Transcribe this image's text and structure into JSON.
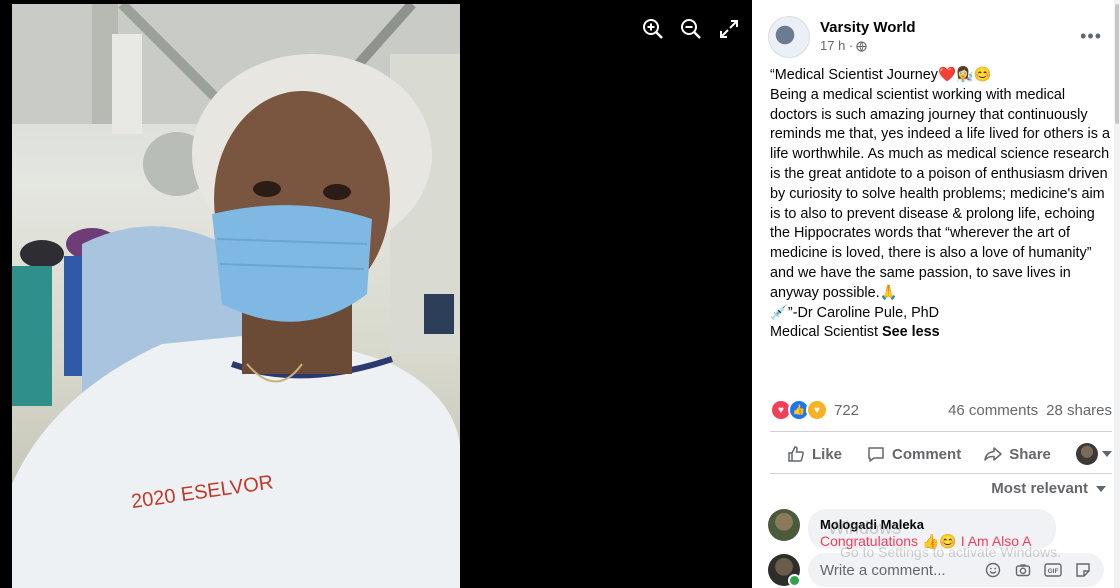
{
  "viewer": {
    "icons": [
      "zoom-in-icon",
      "zoom-out-icon",
      "fullscreen-icon"
    ],
    "photo_text": "2020 ESELVOR"
  },
  "post": {
    "page_name": "Varsity World",
    "time": "17 h ·",
    "body_lines": [
      "“Medical Scientist Journey❤️👩‍🔬😊",
      "Being a medical scientist working with medical doctors is such amazing journey that continuously reminds me that, yes indeed a life lived for others is a life worthwhile. As much as medical science research is the great antidote to a poison of enthusiasm driven by curiosity to solve health problems; medicine's aim is to also to prevent disease & prolong life, echoing the Hippocrates words that “wherever the art of medicine is loved, there is also a love of humanity” and we have the same passion, to save lives in anyway possible.🙏",
      "💉”-Dr Caroline Pule, PhD",
      "Medical Scientist"
    ],
    "see_less": "See less",
    "reaction_count": "722",
    "comments_count": "46 comments",
    "shares_count": "28 shares"
  },
  "actions": {
    "like": "Like",
    "comment": "Comment",
    "share": "Share"
  },
  "comments": {
    "sort_label": "Most relevant",
    "items": [
      {
        "name": "Mologadi Maleka",
        "text": "Congratulations 👍😊 I Am Also A"
      }
    ],
    "write_placeholder": "Write a comment..."
  },
  "watermark": {
    "line1": "Windows",
    "line2": "Go to Settings to activate Windows."
  },
  "colors": {
    "accent": "#1877f2",
    "love": "#f33e58",
    "muted_text": "#65676b"
  }
}
